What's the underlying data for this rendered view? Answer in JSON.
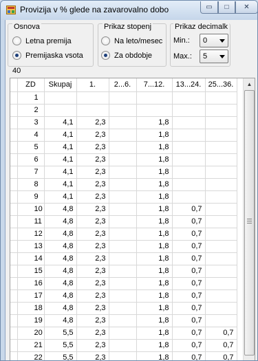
{
  "window": {
    "title": "Provizija v % glede na zavarovalno dobo",
    "buttons": {
      "minimize": "▭",
      "maximize": "□",
      "close": "✕"
    }
  },
  "osnova": {
    "legend": "Osnova",
    "options": [
      {
        "label": "Letna premija",
        "checked": false
      },
      {
        "label": "Premijaska vsota",
        "checked": true
      }
    ]
  },
  "prikaz_stopenj": {
    "legend": "Prikaz stopenj",
    "options": [
      {
        "label": "Na leto/mesec",
        "checked": false
      },
      {
        "label": "Za obdobje",
        "checked": true
      }
    ]
  },
  "prikaz_decimalk": {
    "legend": "Prikaz decimalk",
    "min_label": "Min.:",
    "min_value": "0",
    "max_label": "Max.:",
    "max_value": "5"
  },
  "record_count": "40",
  "grid": {
    "columns": [
      "ZD",
      "Skupaj",
      "1.",
      "2...6.",
      "7...12.",
      "13...24.",
      "25...36."
    ],
    "rows": [
      [
        "1",
        "",
        "",
        "",
        "",
        "",
        ""
      ],
      [
        "2",
        "",
        "",
        "",
        "",
        "",
        ""
      ],
      [
        "3",
        "4,1",
        "2,3",
        "",
        "1,8",
        "",
        ""
      ],
      [
        "4",
        "4,1",
        "2,3",
        "",
        "1,8",
        "",
        ""
      ],
      [
        "5",
        "4,1",
        "2,3",
        "",
        "1,8",
        "",
        ""
      ],
      [
        "6",
        "4,1",
        "2,3",
        "",
        "1,8",
        "",
        ""
      ],
      [
        "7",
        "4,1",
        "2,3",
        "",
        "1,8",
        "",
        ""
      ],
      [
        "8",
        "4,1",
        "2,3",
        "",
        "1,8",
        "",
        ""
      ],
      [
        "9",
        "4,1",
        "2,3",
        "",
        "1,8",
        "",
        ""
      ],
      [
        "10",
        "4,8",
        "2,3",
        "",
        "1,8",
        "0,7",
        ""
      ],
      [
        "11",
        "4,8",
        "2,3",
        "",
        "1,8",
        "0,7",
        ""
      ],
      [
        "12",
        "4,8",
        "2,3",
        "",
        "1,8",
        "0,7",
        ""
      ],
      [
        "13",
        "4,8",
        "2,3",
        "",
        "1,8",
        "0,7",
        ""
      ],
      [
        "14",
        "4,8",
        "2,3",
        "",
        "1,8",
        "0,7",
        ""
      ],
      [
        "15",
        "4,8",
        "2,3",
        "",
        "1,8",
        "0,7",
        ""
      ],
      [
        "16",
        "4,8",
        "2,3",
        "",
        "1,8",
        "0,7",
        ""
      ],
      [
        "17",
        "4,8",
        "2,3",
        "",
        "1,8",
        "0,7",
        ""
      ],
      [
        "18",
        "4,8",
        "2,3",
        "",
        "1,8",
        "0,7",
        ""
      ],
      [
        "19",
        "4,8",
        "2,3",
        "",
        "1,8",
        "0,7",
        ""
      ],
      [
        "20",
        "5,5",
        "2,3",
        "",
        "1,8",
        "0,7",
        "0,7"
      ],
      [
        "21",
        "5,5",
        "2,3",
        "",
        "1,8",
        "0,7",
        "0,7"
      ],
      [
        "22",
        "5,5",
        "2,3",
        "",
        "1,8",
        "0,7",
        "0,7"
      ]
    ]
  }
}
